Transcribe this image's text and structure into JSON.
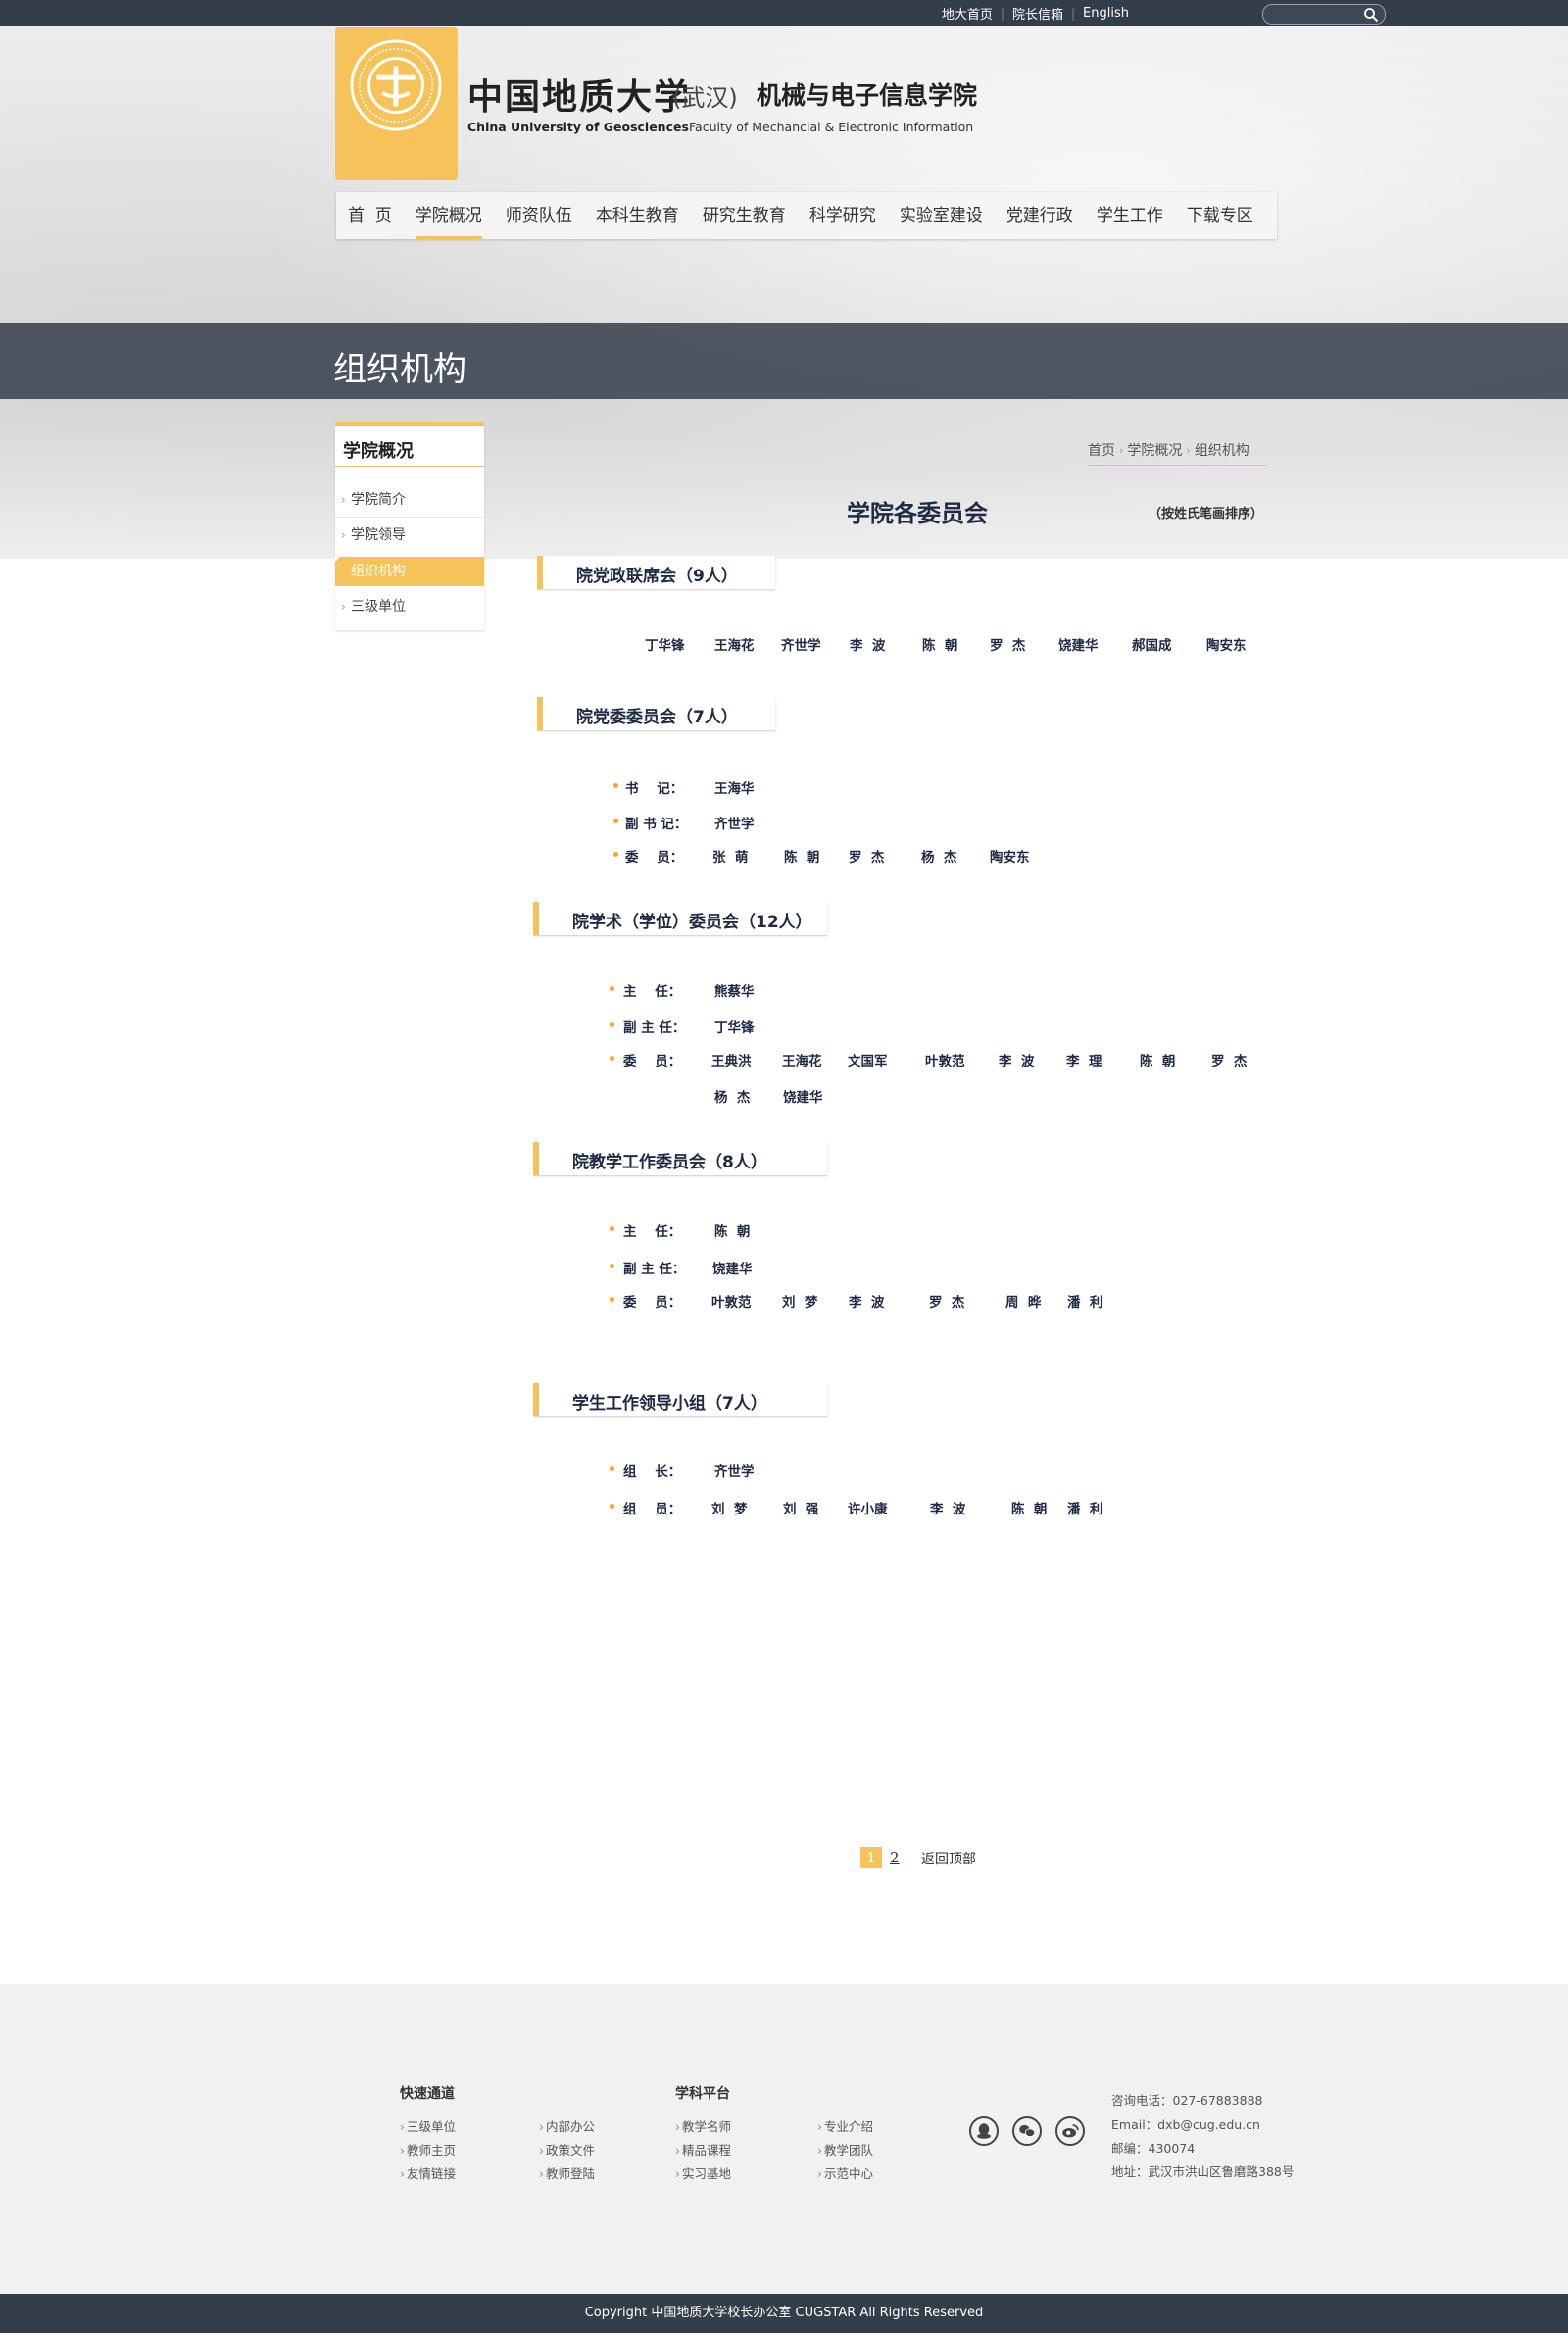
{
  "top_links": [
    "地大首页",
    "院长信箱",
    "English"
  ],
  "search": {
    "placeholder": ""
  },
  "logo": {
    "school_cn": "中国地质大学",
    "school_cn_sub": "(武汉)",
    "faculty_cn": "机械与电子信息学院",
    "school_en": "China University of Geosciences",
    "faculty_en": "Faculty of Mechancial & Electronic Information"
  },
  "nav": [
    {
      "label": "首  页"
    },
    {
      "label": "学院概况",
      "active": true
    },
    {
      "label": "师资队伍"
    },
    {
      "label": "本科生教育"
    },
    {
      "label": "研究生教育"
    },
    {
      "label": "科学研究"
    },
    {
      "label": "实验室建设"
    },
    {
      "label": "党建行政"
    },
    {
      "label": "学生工作"
    },
    {
      "label": "下载专区"
    }
  ],
  "band_title": "组织机构",
  "sidebar": {
    "title": "学院概况",
    "items": [
      {
        "label": "学院简介"
      },
      {
        "label": "学院领导"
      },
      {
        "label": "组织机构",
        "active": true
      },
      {
        "label": "三级单位"
      }
    ]
  },
  "breadcrumb": [
    "首页",
    "学院概况",
    "组织机构"
  ],
  "main_title": "学院各委员会",
  "main_note": "（按姓氏笔画排序）",
  "sections": [
    {
      "title": "院党政联席会（9人）",
      "members": [
        "丁华锋",
        "王海花",
        "齐世学",
        "李  波",
        "陈  朝",
        "罗  杰",
        "饶建华",
        "郝国成",
        "陶安东"
      ]
    },
    {
      "title": "院党委委员会（7人）",
      "roles": [
        {
          "role": "书    记：",
          "names": [
            "王海华"
          ]
        },
        {
          "role": "副 书 记：",
          "names": [
            "齐世学"
          ]
        },
        {
          "role": "委    员：",
          "names": [
            "张  萌",
            "陈  朝",
            "罗  杰",
            "杨  杰",
            "陶安东"
          ]
        }
      ]
    },
    {
      "title": "院学术（学位）委员会（12人）",
      "roles": [
        {
          "role": "主    任：",
          "names": [
            "熊蔡华"
          ]
        },
        {
          "role": "副 主 任：",
          "names": [
            "丁华锋"
          ]
        },
        {
          "role": "委    员：",
          "names": [
            "王典洪",
            "王海花",
            "文国军",
            "叶敦范",
            "李  波",
            "李  理",
            "陈  朝",
            "罗  杰"
          ]
        },
        {
          "role": "",
          "names": [
            "杨  杰",
            "饶建华"
          ]
        }
      ]
    },
    {
      "title": "院教学工作委员会（8人）",
      "roles": [
        {
          "role": "主    任：",
          "names": [
            "陈  朝"
          ]
        },
        {
          "role": "副 主 任：",
          "names": [
            "饶建华"
          ]
        },
        {
          "role": "委    员：",
          "names": [
            "叶敦范",
            "刘  梦",
            "李  波",
            "罗  杰",
            "周  晔",
            "潘  利"
          ]
        }
      ]
    },
    {
      "title": "学生工作领导小组（7人）",
      "roles": [
        {
          "role": "组    长：",
          "names": [
            "齐世学"
          ]
        },
        {
          "role": "组    员：",
          "names": [
            "刘  梦",
            "刘  强",
            "许小康",
            "李  波",
            "陈  朝",
            "潘  利"
          ]
        }
      ]
    }
  ],
  "pagination": {
    "pages": [
      "1",
      "2"
    ],
    "current": "1",
    "back_to_top": "返回顶部"
  },
  "footer": {
    "quick_title": "快速通道",
    "quick_links_col1": [
      "三级单位",
      "教师主页",
      "友情链接"
    ],
    "quick_links_col2": [
      "内部办公",
      "政策文件",
      "教师登陆"
    ],
    "platform_title": "学科平台",
    "platform_col1": [
      "教学名师",
      "精品课程",
      "实习基地"
    ],
    "platform_col2": [
      "专业介绍",
      "教学团队",
      "示范中心"
    ],
    "social_icons": [
      "qq-icon",
      "wechat-icon",
      "weibo-icon"
    ],
    "contact": [
      "咨询电话：027-67883888",
      "Email：dxb@cug.edu.cn",
      "邮编：430074",
      "地址：武汉市洪山区鲁磨路388号"
    ]
  },
  "copyright": "Copyright 中国地质大学校长办公室 CUGSTAR All Rights Reserved",
  "colors": {
    "accent": "#f6c35a",
    "dark": "#343d4a",
    "heading": "#1f2a44"
  }
}
